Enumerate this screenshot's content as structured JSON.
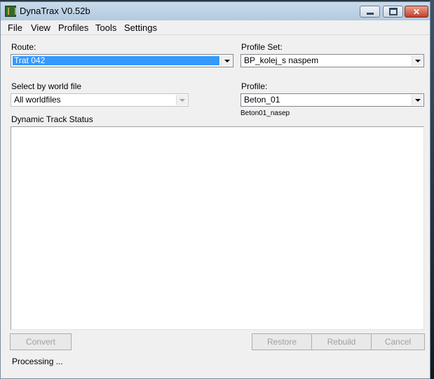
{
  "window": {
    "title": "DynaTrax V0.52b"
  },
  "menu": [
    "File",
    "View",
    "Profiles",
    "Tools",
    "Settings"
  ],
  "route": {
    "label": "Route:",
    "value": "Trat 042"
  },
  "profile_set": {
    "label": "Profile Set:",
    "value": "BP_kolej_s naspem"
  },
  "world_file": {
    "label": "Select by world file",
    "value": "All worldfiles"
  },
  "profile": {
    "label": "Profile:",
    "value": "Beton_01",
    "sublabel": "Beton01_nasep"
  },
  "status_panel": {
    "label": "Dynamic Track Status"
  },
  "buttons": {
    "convert": "Convert",
    "restore": "Restore",
    "rebuild": "Rebuild",
    "cancel": "Cancel"
  },
  "status_text": "Processing ...",
  "colors": {
    "selection": "#3399ff",
    "window_bg": "#f0f0f0"
  }
}
